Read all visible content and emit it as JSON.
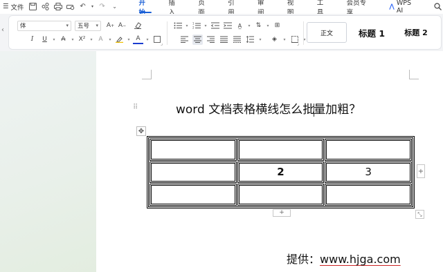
{
  "menubar": {
    "menu_icon": "hamburger-icon",
    "file_label": "文件",
    "quick_access": [
      "save-icon",
      "share-icon",
      "print-icon",
      "print-preview-icon",
      "undo-icon",
      "redo-icon",
      "more-icon"
    ],
    "tabs": [
      {
        "label": "开始",
        "active": true
      },
      {
        "label": "插入"
      },
      {
        "label": "页面"
      },
      {
        "label": "引用"
      },
      {
        "label": "审阅"
      },
      {
        "label": "视图"
      },
      {
        "label": "工具"
      },
      {
        "label": "会员专享"
      }
    ],
    "ai_label": "WPS AI"
  },
  "ribbon": {
    "font_name": "宋体",
    "font_name_visible": "体",
    "font_size": "五号",
    "font_buttons": {
      "grow": "A⁺",
      "shrink": "A⁻",
      "italic": "I",
      "underline": "U",
      "strike": "A",
      "superscript": "X²",
      "font_color": "A",
      "font_color_hex": "#1a3ccf"
    },
    "styles": {
      "body": "正文",
      "heading1": "标题 1",
      "heading2": "标题 2"
    }
  },
  "document": {
    "title_before_cursor": "word 文档表格横线怎么批",
    "title_after_cursor": "量加粗？",
    "table": [
      [
        "",
        "",
        ""
      ],
      [
        "",
        "2",
        "3"
      ],
      [
        "",
        "",
        ""
      ]
    ],
    "table_controls": {
      "move": "✥",
      "add_column": "+",
      "add_row": "+",
      "resize": "⤡"
    },
    "credit_prefix": "提供：",
    "credit_url": "www.hjga.com"
  }
}
